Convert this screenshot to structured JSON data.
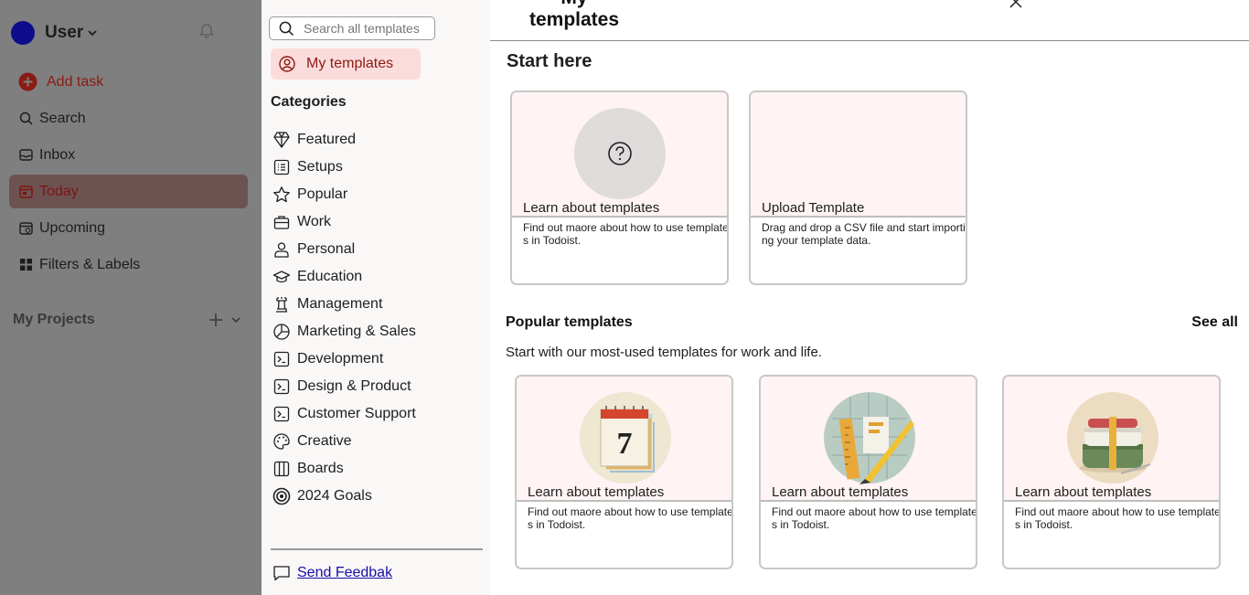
{
  "sidebar": {
    "user_name": "User",
    "nav": [
      {
        "label": "Add task",
        "icon": "add-circle-icon"
      },
      {
        "label": "Search",
        "icon": "search-icon"
      },
      {
        "label": "Inbox",
        "icon": "inbox-icon"
      },
      {
        "label": "Today",
        "icon": "calendar-today-icon"
      },
      {
        "label": "Upcoming",
        "icon": "calendar-upcoming-icon"
      },
      {
        "label": "Filters & Labels",
        "icon": "grid-icon"
      }
    ],
    "projects_title": "My Projects"
  },
  "templates_sidebar": {
    "search_placeholder": "Search all templates",
    "my_templates_label": "My templates",
    "categories_title": "Categories",
    "categories": [
      "Featured",
      "Setups",
      "Popular",
      "Work",
      "Personal",
      "Education",
      "Management",
      "Marketing & Sales",
      "Development",
      "Design & Product",
      "Customer Support",
      "Creative",
      "Boards",
      "2024 Goals"
    ],
    "feedback_label": "Send Feedbak"
  },
  "main": {
    "title": "My templates",
    "start_here_title": "Start here",
    "start_cards": [
      {
        "title": "Learn about templates",
        "desc": "Find out maore about how to use templates in Todoist."
      },
      {
        "title": "Upload Template",
        "desc": "Drag and drop a CSV file and start importing your template data."
      }
    ],
    "popular_title": "Popular templates",
    "see_all_label": "See all",
    "popular_subtitle": "Start with our most-used templates for work and life.",
    "popular_cards": [
      {
        "title": "Learn about templates",
        "desc": "Find out maore about how to use templates in Todoist.",
        "illustration": "calendar-7"
      },
      {
        "title": "Learn about templates",
        "desc": "Find out maore about how to use templates in Todoist.",
        "illustration": "design-tools"
      },
      {
        "title": "Learn about templates",
        "desc": "Find out maore about how to use templates in Todoist.",
        "illustration": "lunch-box"
      }
    ]
  },
  "colors": {
    "accent": "#8c1c14",
    "dim_sidebar": "#7f7f7f",
    "active_item": "#6d5252",
    "card_top": "#fff3f3",
    "avatar": "#0d0d8c"
  }
}
